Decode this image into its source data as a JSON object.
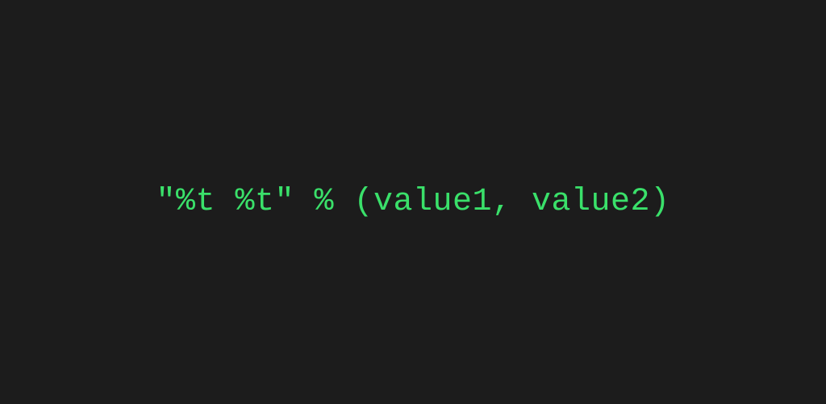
{
  "code": {
    "content": "\"%t %t\" % (value1, value2)"
  }
}
